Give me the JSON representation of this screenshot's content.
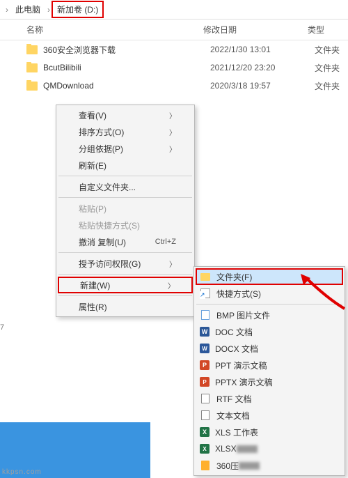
{
  "breadcrumb": {
    "prefix": "›",
    "parent": "此电脑",
    "sep": "›",
    "current": "新加卷 (D:)"
  },
  "columns": {
    "name": "名称",
    "date": "修改日期",
    "type": "类型"
  },
  "files": [
    {
      "name": "360安全浏览器下载",
      "date": "2022/1/30 13:01",
      "type": "文件夹"
    },
    {
      "name": "BcutBilibili",
      "date": "2021/12/20 23:20",
      "type": "文件夹"
    },
    {
      "name": "QMDownload",
      "date": "2020/3/18 19:57",
      "type": "文件夹"
    }
  ],
  "context_menu": {
    "view": "查看(V)",
    "sort": "排序方式(O)",
    "group": "分组依据(P)",
    "refresh": "刷新(E)",
    "customize": "自定义文件夹...",
    "paste": "粘贴(P)",
    "paste_shortcut": "粘贴快捷方式(S)",
    "undo": "撤消 复制(U)",
    "undo_key": "Ctrl+Z",
    "grant": "授予访问权限(G)",
    "new": "新建(W)",
    "properties": "属性(R)"
  },
  "submenu": {
    "folder": "文件夹(F)",
    "shortcut": "快捷方式(S)",
    "bmp": "BMP 图片文件",
    "doc": "DOC 文档",
    "docx": "DOCX 文档",
    "ppt": "PPT 演示文稿",
    "pptx": "PPTX 演示文稿",
    "rtf": "RTF 文档",
    "txt": "文本文档",
    "xls": "XLS 工作表",
    "xlsx": "XLSX",
    "zip": "360压"
  },
  "watermark": "kkpsn.com"
}
